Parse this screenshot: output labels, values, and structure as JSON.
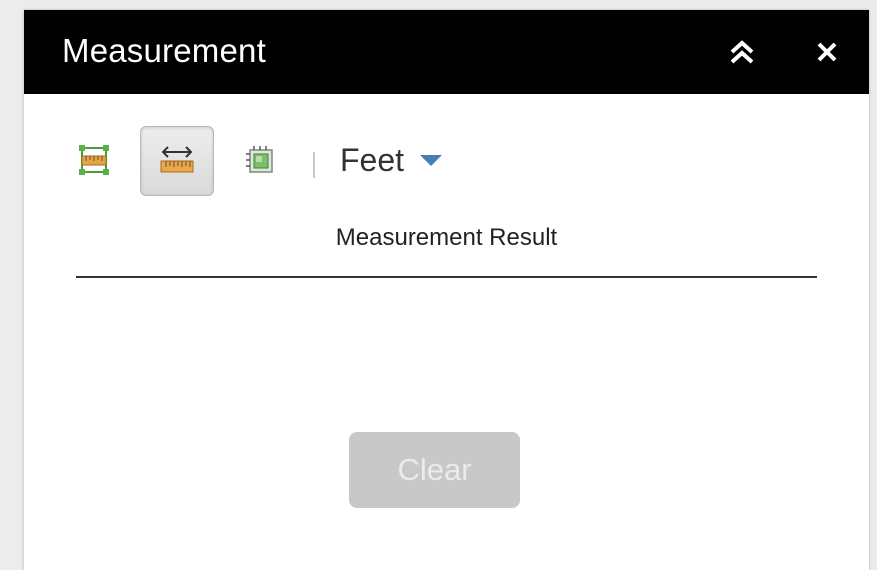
{
  "widget": {
    "title": "Measurement",
    "header_controls": {
      "collapse_icon": "chevron-double-up-icon",
      "close_icon": "close-icon",
      "close_glyph": "✕"
    }
  },
  "toolbar": {
    "tools": [
      {
        "name": "area",
        "icon": "area-measure-icon",
        "selected": false
      },
      {
        "name": "distance",
        "icon": "distance-measure-icon",
        "selected": true
      },
      {
        "name": "location",
        "icon": "location-measure-icon",
        "selected": false
      }
    ],
    "unit": {
      "selected": "Feet"
    }
  },
  "result": {
    "label": "Measurement Result",
    "value": ""
  },
  "actions": {
    "clear_label": "Clear",
    "clear_enabled": false
  },
  "colors": {
    "header_bg": "#000000",
    "header_text": "#ffffff",
    "selected_tool_bg": "#e2e2e2",
    "caret": "#4a7fb5",
    "disabled_button": "#c8c8c8"
  }
}
